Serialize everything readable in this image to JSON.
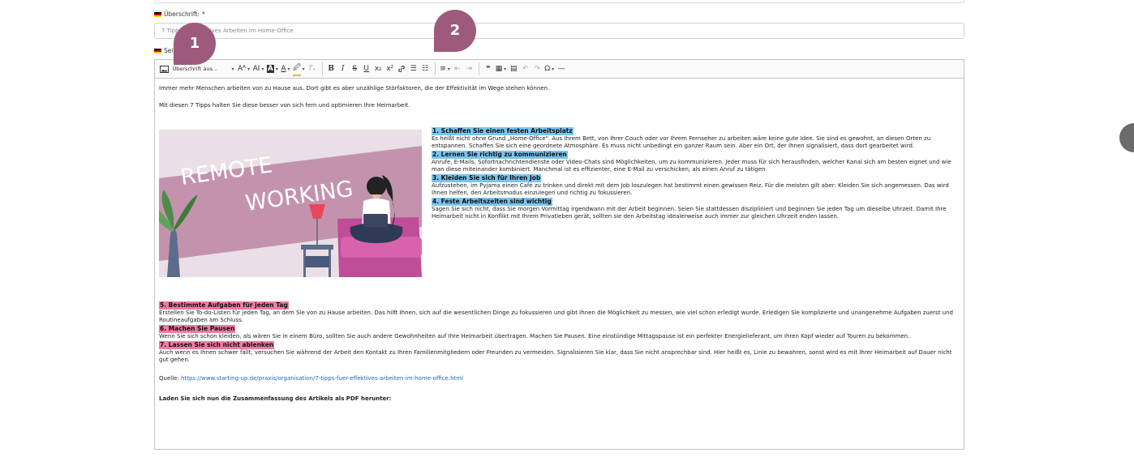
{
  "heading_field": {
    "label": "Überschrift:",
    "required_mark": "*",
    "value": "7 Tipps für effektives Arbeiten im Home-Office"
  },
  "content_field": {
    "label": "Seiteninhalt"
  },
  "toolbar": {
    "heading_select": "Überschrift aus...",
    "font_size": "Aᴬ",
    "font_family": "AI",
    "bg_color": "A",
    "font_color": "A",
    "highlight": "🖉",
    "clear_format": "Tₓ",
    "bold": "B",
    "italic": "I",
    "strike": "S",
    "underline": "U",
    "subscript": "x₂",
    "superscript": "x²",
    "link": "🔗",
    "bullet_list": "☰",
    "numbered_list": "☷",
    "align": "≡",
    "outdent": "⇤",
    "indent": "⇥",
    "quote": "❝",
    "table": "▦",
    "media": "▤",
    "undo": "↶",
    "redo": "↷",
    "special_chars": "Ω",
    "horizontal_line": "—",
    "caret": "▾"
  },
  "content": {
    "intro1": "Immer mehr Menschen arbeiten von zu Hause aus. Dort gibt es aber unzählige Störfaktoren, die der Effektivität im Wege stehen können.",
    "intro2": "Mit diesen 7 Tipps halten Sie diese besser von sich fern und optimieren Ihre Heimarbeit.",
    "image_text_1": "REMOTE",
    "image_text_2": "WORKING",
    "sections_side": [
      {
        "heading": "1. Schaffen Sie einen festen Arbeitsplatz",
        "text": "Es heißt nicht ohne Grund „Home-Office\". Aus Ihrem Bett, von Ihrer Couch oder vor Ihrem Fernseher zu arbeiten wäre keine gute Idee. Sie sind es gewohnt, an diesen Orten zu entspannen. Schaffen Sie sich eine geordnete Atmosphäre. Es muss nicht unbedingt ein ganzer Raum sein. Aber ein Ort, der Ihnen signalisiert, dass dort gearbeitet wird."
      },
      {
        "heading": "2. Lernen Sie richtig zu kommunizieren",
        "text": "Anrufe, E-Mails, Sofortnachrichtendienste oder Video-Chats sind Möglichkeiten, um zu kommunizieren. Jeder muss für sich herausfinden, welcher Kanal sich am besten eignet und wie man diese miteinander kombiniert. Manchmal ist es effizienter, eine E-Mail zu verschicken, als einen Anruf zu tätigen."
      },
      {
        "heading": "3. Kleiden Sie sich für Ihren Job",
        "text": "Aufzustehen, im Pyjama einen Café zu trinken und direkt mit dem Job loszulegen hat bestimmt einen gewissen Reiz. Für die meisten gilt aber: Kleiden Sie sich angemessen. Das wird Ihnen helfen, den Arbeitsmodus einzulegen und richtig zu fokussieren."
      },
      {
        "heading": "4. Feste Arbeitszeiten sind wichtig",
        "text": "Sagen Sie sich nicht, dass Sie morgen Vormittag irgendwann mit der Arbeit beginnen. Seien Sie stattdessen diszipliniert und beginnen Sie jeden Tag um dieselbe Uhrzeit. Damit Ihre Heimarbeit nicht in Konflikt mit Ihrem Privatleben gerät, sollten sie den Arbeitstag idealerweise auch immer zur gleichen Uhrzeit enden lassen."
      }
    ],
    "sections_lower": [
      {
        "heading": "5. Bestimmte Aufgaben für jeden Tag",
        "text": "Erstellen Sie To-do-Listen für jeden Tag, an dem Sie von zu Hause arbeiten. Das hilft Ihnen, sich auf die wesentlichen Dinge zu fokussieren und gibt Ihnen die Möglichkeit zu messen, wie viel schon erledigt wurde. Erledigen Sie komplizierte und unangenehme Aufgaben zuerst und Routineaufgaben am Schluss."
      },
      {
        "heading": "6. Machen Sie Pausen",
        "text": "Wenn Sie sich schon kleiden, als wären Sie in einem Büro, sollten Sie auch andere Gewohnheiten auf Ihre Heimarbeit übertragen. Machen Sie Pausen. Eine einstündige Mittagspause ist ein perfekter Energielieferant, um Ihren Kopf wieder auf Touren zu bekommen."
      },
      {
        "heading": "7. Lassen Sie sich nicht ablenken",
        "text": "Auch wenn es Ihnen schwer fällt, versuchen Sie während der Arbeit den Kontakt zu Ihren Familienmitgliedern oder Freunden zu vermeiden. Signalisieren Sie klar, dass Sie nicht ansprechbar sind. Hier heißt es, Linie zu bewahren, sonst wird es mit Ihrer Heimarbeit auf Dauer nicht gut gehen."
      }
    ],
    "source_label": "Quelle:",
    "source_url": "https://www.starting-up.de/praxis/organisation/7-tipps-fuer-effektives-arbeiten-im-home-office.html",
    "final_line": "Laden Sie sich nun die Zusammenfassung des Artikels als PDF herunter:"
  },
  "badges": {
    "one": "1",
    "two": "2"
  },
  "colors": {
    "badge": "#9e5a7c",
    "hl_blue": "#7ac4ee",
    "hl_pink": "#f07ca0",
    "link": "#2168b4"
  }
}
